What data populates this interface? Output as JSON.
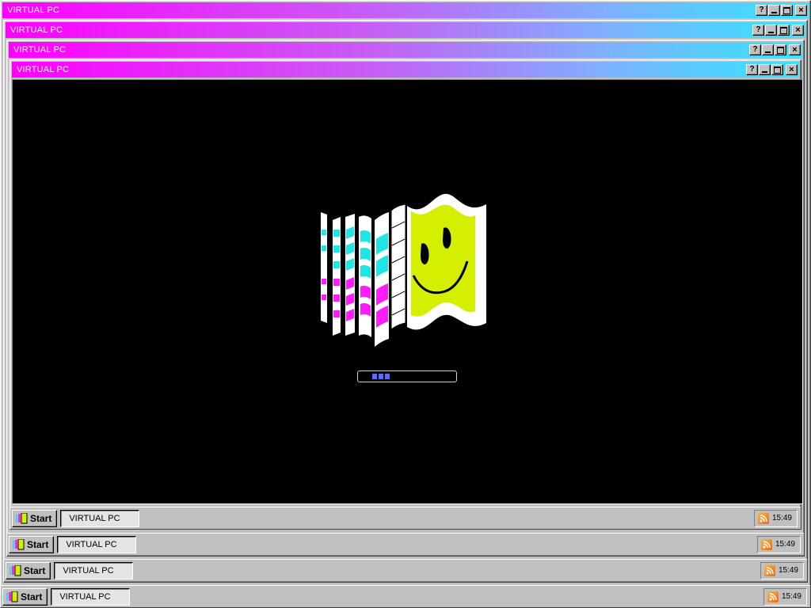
{
  "windows": [
    {
      "title": "VIRTUAL PC"
    },
    {
      "title": "VIRTUAL PC"
    },
    {
      "title": "VIRTUAL PC"
    },
    {
      "title": "VIRTUAL PC"
    }
  ],
  "title_buttons": {
    "help": "?",
    "close": "×"
  },
  "taskbars": [
    {
      "start_label": "Start",
      "task_label": "VIRTUAL PC",
      "clock": "15:49"
    },
    {
      "start_label": "Start",
      "task_label": "VIRTUAL PC",
      "clock": "15:49"
    },
    {
      "start_label": "Start",
      "task_label": "VIRTUAL PC",
      "clock": "15:49"
    },
    {
      "start_label": "Start",
      "task_label": "VIRTUAL PC",
      "clock": "15:49"
    }
  ],
  "boot_screen": {
    "logo": "smiley-flag-logo",
    "loading_progress": 0.25,
    "colors": {
      "cyan": "#1ee6e6",
      "magenta": "#ff1aff",
      "lime": "#d4f000"
    }
  }
}
